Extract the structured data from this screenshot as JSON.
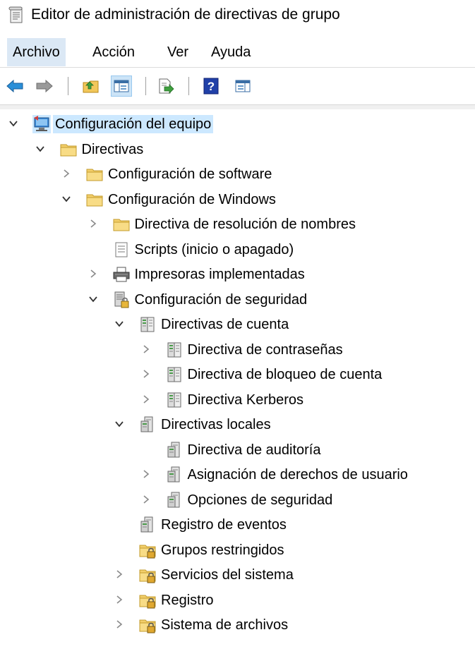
{
  "window": {
    "title": "Editor de administración de directivas de grupo"
  },
  "menu": [
    "Archivo",
    "Acción",
    "Ver",
    "Ayuda"
  ],
  "toolbar": [
    "back-arrow-icon",
    "forward-arrow-icon",
    "up-folder-icon",
    "show-hide-tree-icon",
    "export-list-icon",
    "help-icon",
    "properties-pane-icon"
  ],
  "tree": [
    {
      "label": "Configuración del equipo",
      "level": 0,
      "expander": "expanded",
      "icon": "computer-icon",
      "selected": true
    },
    {
      "label": "Directivas",
      "level": 1,
      "expander": "expanded",
      "icon": "folder-icon"
    },
    {
      "label": "Configuración de software",
      "level": 2,
      "expander": "collapsed",
      "icon": "folder-icon"
    },
    {
      "label": "Configuración de Windows",
      "level": 2,
      "expander": "expanded",
      "icon": "folder-icon"
    },
    {
      "label": "Directiva de resolución de nombres",
      "level": 3,
      "expander": "collapsed",
      "icon": "folder-icon"
    },
    {
      "label": "Scripts (inicio o apagado)",
      "level": 3,
      "expander": "none",
      "icon": "script-icon"
    },
    {
      "label": "Impresoras implementadas",
      "level": 3,
      "expander": "collapsed",
      "icon": "printer-icon"
    },
    {
      "label": "Configuración de seguridad",
      "level": 3,
      "expander": "expanded",
      "icon": "security-settings-icon"
    },
    {
      "label": "Directivas de cuenta",
      "level": 4,
      "expander": "expanded",
      "icon": "policy-stack-icon"
    },
    {
      "label": "Directiva de contraseñas",
      "level": 5,
      "expander": "collapsed",
      "icon": "policy-stack-icon"
    },
    {
      "label": "Directiva de bloqueo de cuenta",
      "level": 5,
      "expander": "collapsed",
      "icon": "policy-stack-icon"
    },
    {
      "label": "Directiva Kerberos",
      "level": 5,
      "expander": "collapsed",
      "icon": "policy-stack-icon"
    },
    {
      "label": "Directivas locales",
      "level": 4,
      "expander": "expanded",
      "icon": "local-policy-icon"
    },
    {
      "label": "Directiva de auditoría",
      "level": 5,
      "expander": "none",
      "icon": "local-policy-icon"
    },
    {
      "label": "Asignación de derechos de usuario",
      "level": 5,
      "expander": "collapsed",
      "icon": "local-policy-icon"
    },
    {
      "label": "Opciones de seguridad",
      "level": 5,
      "expander": "collapsed",
      "icon": "local-policy-icon"
    },
    {
      "label": "Registro de eventos",
      "level": 4,
      "expander": "none",
      "icon": "local-policy-icon"
    },
    {
      "label": "Grupos restringidos",
      "level": 4,
      "expander": "none",
      "icon": "locked-folder-icon"
    },
    {
      "label": "Servicios del sistema",
      "level": 4,
      "expander": "collapsed",
      "icon": "locked-folder-icon"
    },
    {
      "label": "Registro",
      "level": 4,
      "expander": "collapsed",
      "icon": "locked-folder-icon"
    },
    {
      "label": "Sistema de archivos",
      "level": 4,
      "expander": "collapsed",
      "icon": "locked-folder-icon"
    }
  ]
}
